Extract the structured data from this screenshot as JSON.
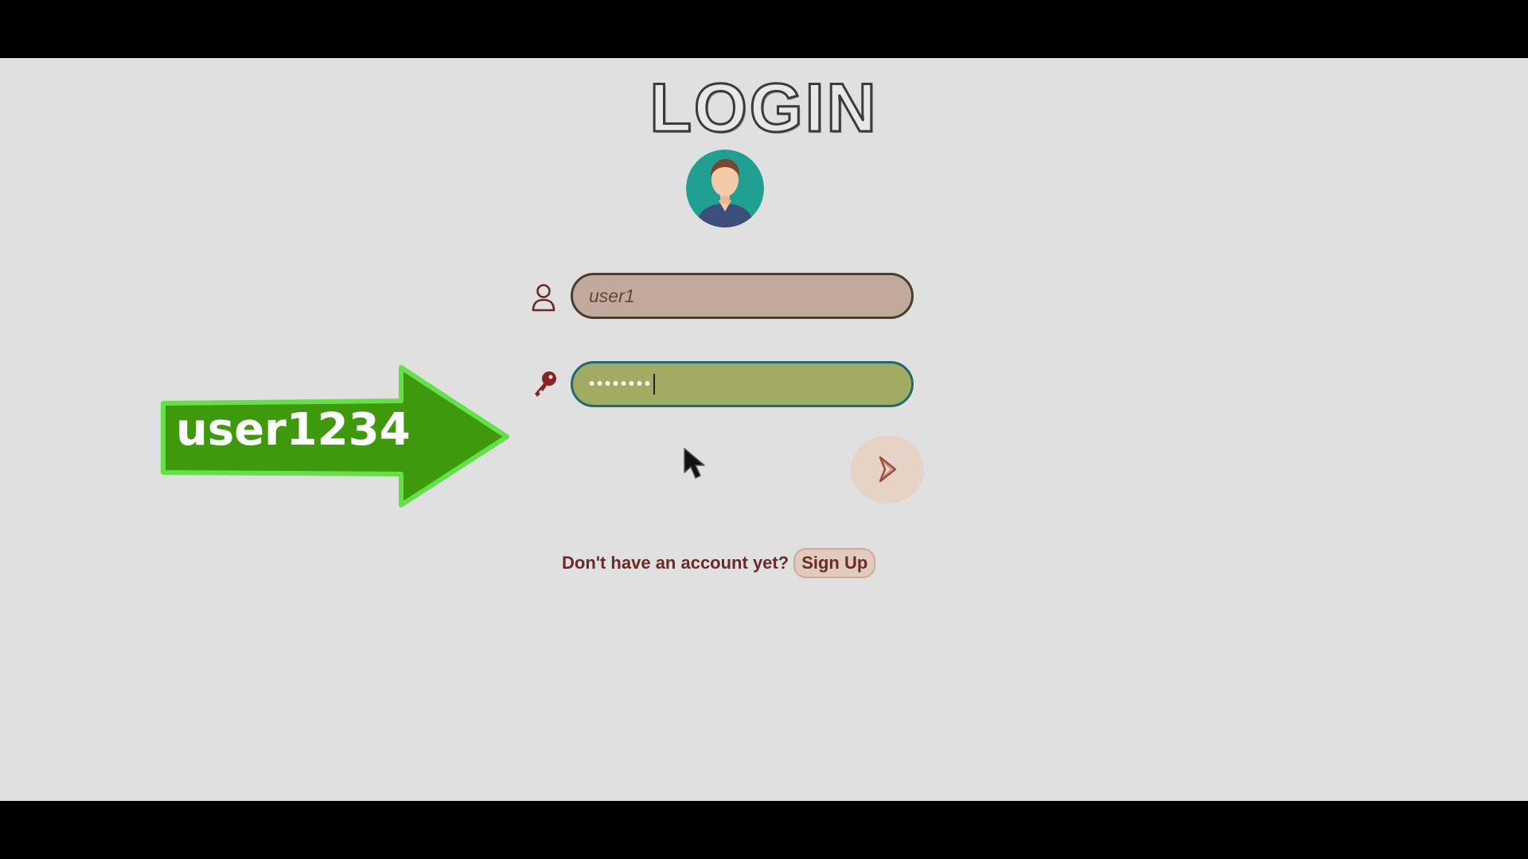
{
  "login": {
    "title": "LOGIN",
    "username_value": "user1",
    "password_mask": "••••••••",
    "signup_prompt": "Don't have an account yet?",
    "signup_label": "Sign Up"
  },
  "annotation": {
    "text": "user1234"
  },
  "icons": {
    "user": "user-icon",
    "key": "key-icon",
    "submit": "chevron-right-icon",
    "avatar": "avatar-icon",
    "cursor": "mouse-cursor-icon"
  },
  "colors": {
    "background": "#e0e0e0",
    "username_field": "#c1aa9b",
    "password_field": "#a1ab62",
    "password_border": "#1f6a73",
    "accent_text": "#6a2a2a",
    "annotation_green": "#3e9a0c",
    "annotation_outline": "#66e04a",
    "avatar_teal": "#1fa093"
  }
}
